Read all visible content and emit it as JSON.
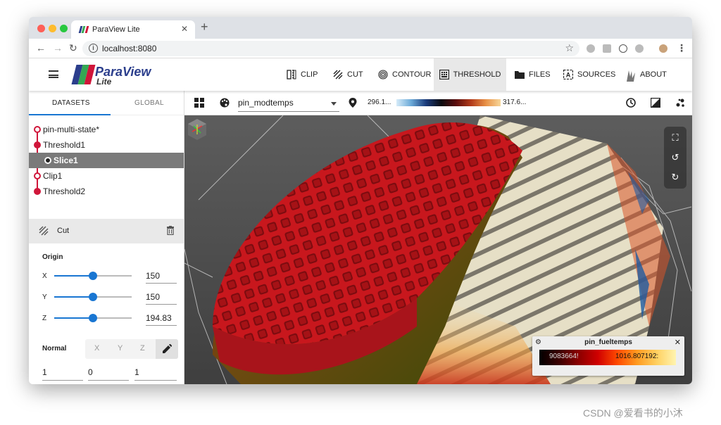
{
  "browser": {
    "tab_title": "ParaView Lite",
    "url": "localhost:8080",
    "traffic_lights": [
      "#fe5f57",
      "#febc2e",
      "#28c840"
    ]
  },
  "app": {
    "logo_name": "ParaView",
    "logo_sub": "Lite",
    "logo_colors": [
      "#2b3e8c",
      "#34a853",
      "#d0163a"
    ],
    "menu": [
      {
        "label": "CLIP",
        "icon": "clip-icon"
      },
      {
        "label": "CUT",
        "icon": "cut-icon"
      },
      {
        "label": "CONTOUR",
        "icon": "contour-icon"
      },
      {
        "label": "THRESHOLD",
        "icon": "threshold-icon",
        "active": true
      },
      {
        "label": "FILES",
        "icon": "folder-icon"
      },
      {
        "label": "SOURCES",
        "icon": "sources-icon"
      },
      {
        "label": "ABOUT",
        "icon": "about-icon"
      }
    ]
  },
  "panel": {
    "tabs": [
      "DATASETS",
      "GLOBAL"
    ],
    "pipeline": [
      {
        "label": "pin-multi-state*",
        "indent": false,
        "selected": false
      },
      {
        "label": "Threshold1",
        "indent": false,
        "selected": false
      },
      {
        "label": "Slice1",
        "indent": true,
        "selected": true
      },
      {
        "label": "Clip1",
        "indent": false,
        "selected": false
      },
      {
        "label": "Threshold2",
        "indent": false,
        "selected": false
      }
    ],
    "filter_name": "Cut",
    "origin_label": "Origin",
    "origin": [
      {
        "axis": "X",
        "value": "150",
        "fraction": 0.5
      },
      {
        "axis": "Y",
        "value": "150",
        "fraction": 0.5
      },
      {
        "axis": "Z",
        "value": "194.83",
        "fraction": 0.5
      }
    ],
    "normal_label": "Normal",
    "normal_buttons": [
      "X",
      "Y",
      "Z"
    ],
    "normal_values": [
      "1",
      "0",
      "1"
    ]
  },
  "toolbar": {
    "field": "pin_modtemps",
    "range_min": "296.1...",
    "range_max": "317.6..."
  },
  "legend": {
    "title": "pin_fueltemps",
    "min": "9083664!",
    "max": "1016.807192:"
  },
  "watermark": "CSDN @爱看书的小沐"
}
